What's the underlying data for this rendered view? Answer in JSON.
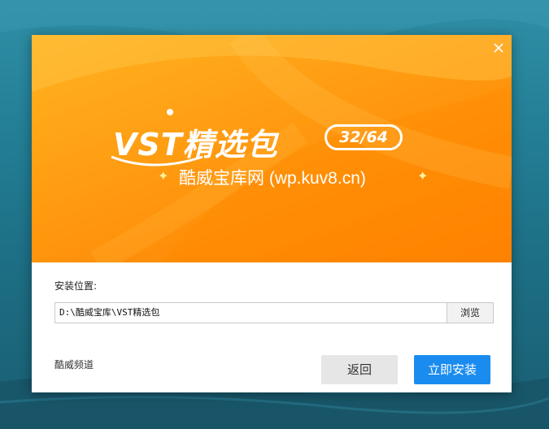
{
  "banner": {
    "title": "VST精选包",
    "badge": "32/64",
    "subtitle": "酷威宝库网 (wp.kuv8.cn)",
    "close_icon": "close-icon",
    "sparkle_left": "✦",
    "sparkle_right": "✦"
  },
  "install": {
    "location_label": "安装位置:",
    "path_value": "D:\\酷威宝库\\VST精选包",
    "browse_label": "浏览"
  },
  "footer": {
    "channel_link": "酷威频道",
    "back_label": "返回",
    "install_label": "立即安装"
  },
  "colors": {
    "banner_orange": "#ff9a10",
    "primary_blue": "#1a8cf0",
    "secondary_gray": "#e6e6e6"
  }
}
